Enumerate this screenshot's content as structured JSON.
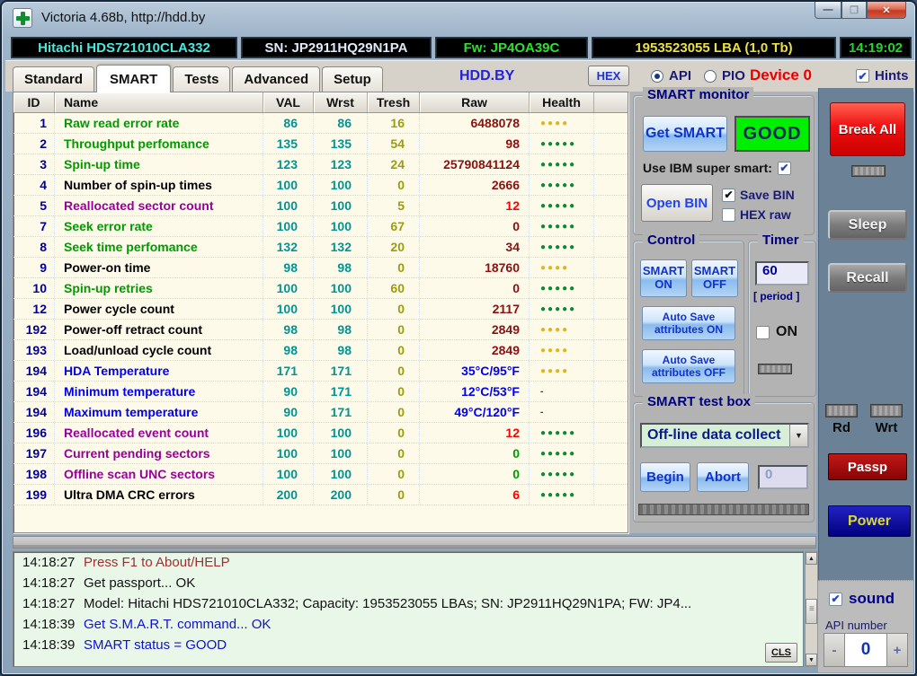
{
  "window": {
    "title": "Victoria 4.68b, http://hdd.by"
  },
  "info_bar": {
    "model": "Hitachi HDS721010CLA332",
    "serial": "SN: JP2911HQ29N1PA",
    "firmware": "Fw: JP4OA39C",
    "capacity": "1953523055 LBA (1,0 Tb)",
    "clock": "14:19:02"
  },
  "tab_bar": {
    "tabs": [
      "Standard",
      "SMART",
      "Tests",
      "Advanced",
      "Setup"
    ],
    "active_tab": "SMART",
    "site": "HDD.BY",
    "hex_button": "HEX",
    "api_label": "API",
    "pio_label": "PIO",
    "device_label": "Device 0",
    "hints_label": "Hints"
  },
  "table": {
    "columns": [
      "ID",
      "Name",
      "VAL",
      "Wrst",
      "Tresh",
      "Raw",
      "Health"
    ],
    "rows": [
      {
        "id": "1",
        "name": "Raw read error rate",
        "name_color": "green",
        "val": "86",
        "wrst": "86",
        "tresh": "16",
        "raw": "6488078",
        "raw_color": "maroon",
        "health_dots": 4,
        "health_color": "yellow"
      },
      {
        "id": "2",
        "name": "Throughput perfomance",
        "name_color": "green",
        "val": "135",
        "wrst": "135",
        "tresh": "54",
        "raw": "98",
        "raw_color": "maroon",
        "health_dots": 5,
        "health_color": "green"
      },
      {
        "id": "3",
        "name": "Spin-up time",
        "name_color": "green",
        "val": "123",
        "wrst": "123",
        "tresh": "24",
        "raw": "25790841124",
        "raw_color": "maroon",
        "health_dots": 5,
        "health_color": "green"
      },
      {
        "id": "4",
        "name": "Number of spin-up times",
        "name_color": "black",
        "val": "100",
        "wrst": "100",
        "tresh": "0",
        "raw": "2666",
        "raw_color": "maroon",
        "health_dots": 5,
        "health_color": "green"
      },
      {
        "id": "5",
        "name": "Reallocated sector count",
        "name_color": "purple",
        "val": "100",
        "wrst": "100",
        "tresh": "5",
        "raw": "12",
        "raw_color": "red",
        "health_dots": 5,
        "health_color": "green"
      },
      {
        "id": "7",
        "name": "Seek error rate",
        "name_color": "green",
        "val": "100",
        "wrst": "100",
        "tresh": "67",
        "raw": "0",
        "raw_color": "maroon",
        "health_dots": 5,
        "health_color": "green"
      },
      {
        "id": "8",
        "name": "Seek time perfomance",
        "name_color": "green",
        "val": "132",
        "wrst": "132",
        "tresh": "20",
        "raw": "34",
        "raw_color": "maroon",
        "health_dots": 5,
        "health_color": "green"
      },
      {
        "id": "9",
        "name": "Power-on time",
        "name_color": "black",
        "val": "98",
        "wrst": "98",
        "tresh": "0",
        "raw": "18760",
        "raw_color": "maroon",
        "health_dots": 4,
        "health_color": "yellow"
      },
      {
        "id": "10",
        "name": "Spin-up retries",
        "name_color": "green",
        "val": "100",
        "wrst": "100",
        "tresh": "60",
        "raw": "0",
        "raw_color": "maroon",
        "health_dots": 5,
        "health_color": "green"
      },
      {
        "id": "12",
        "name": "Power cycle count",
        "name_color": "black",
        "val": "100",
        "wrst": "100",
        "tresh": "0",
        "raw": "2117",
        "raw_color": "maroon",
        "health_dots": 5,
        "health_color": "green"
      },
      {
        "id": "192",
        "name": "Power-off retract count",
        "name_color": "black",
        "val": "98",
        "wrst": "98",
        "tresh": "0",
        "raw": "2849",
        "raw_color": "maroon",
        "health_dots": 4,
        "health_color": "yellow"
      },
      {
        "id": "193",
        "name": "Load/unload cycle count",
        "name_color": "black",
        "val": "98",
        "wrst": "98",
        "tresh": "0",
        "raw": "2849",
        "raw_color": "maroon",
        "health_dots": 4,
        "health_color": "yellow"
      },
      {
        "id": "194",
        "name": "HDA Temperature",
        "name_color": "blue",
        "val": "171",
        "wrst": "171",
        "tresh": "0",
        "raw": "35°C/95°F",
        "raw_color": "blue",
        "health_dots": 4,
        "health_color": "yellow"
      },
      {
        "id": "194",
        "name": "Minimum temperature",
        "name_color": "blue",
        "val": "90",
        "wrst": "171",
        "tresh": "0",
        "raw": "12°C/53°F",
        "raw_color": "blue",
        "health_dots": 0,
        "health_color": "dash"
      },
      {
        "id": "194",
        "name": "Maximum temperature",
        "name_color": "blue",
        "val": "90",
        "wrst": "171",
        "tresh": "0",
        "raw": "49°C/120°F",
        "raw_color": "blue",
        "health_dots": 0,
        "health_color": "dash"
      },
      {
        "id": "196",
        "name": "Reallocated event count",
        "name_color": "purple",
        "val": "100",
        "wrst": "100",
        "tresh": "0",
        "raw": "12",
        "raw_color": "red",
        "health_dots": 5,
        "health_color": "green"
      },
      {
        "id": "197",
        "name": "Current pending sectors",
        "name_color": "purple",
        "val": "100",
        "wrst": "100",
        "tresh": "0",
        "raw": "0",
        "raw_color": "green",
        "health_dots": 5,
        "health_color": "green"
      },
      {
        "id": "198",
        "name": "Offline scan UNC sectors",
        "name_color": "purple",
        "val": "100",
        "wrst": "100",
        "tresh": "0",
        "raw": "0",
        "raw_color": "green",
        "health_dots": 5,
        "health_color": "green"
      },
      {
        "id": "199",
        "name": "Ultra DMA CRC errors",
        "name_color": "black",
        "val": "200",
        "wrst": "200",
        "tresh": "0",
        "raw": "6",
        "raw_color": "red",
        "health_dots": 5,
        "health_color": "green"
      }
    ]
  },
  "smart_monitor": {
    "title": "SMART monitor",
    "get_smart_button": "Get SMART",
    "status": "GOOD",
    "ibm_label": "Use IBM super smart:",
    "open_bin_button": "Open BIN",
    "save_bin_label": "Save BIN",
    "hex_raw_label": "HEX raw",
    "status_color": "#00ef00"
  },
  "control": {
    "title": "Control",
    "smart_on_button": "SMART ON",
    "smart_off_button": "SMART OFF",
    "auto_on_button": "Auto Save attributes ON",
    "auto_off_button": "Auto Save attributes OFF"
  },
  "timer": {
    "title": "Timer",
    "period_value": "60",
    "period_label": "[ period ]",
    "on_label": "ON"
  },
  "test_box": {
    "title": "SMART test box",
    "selected_test": "Off-line data collect",
    "begin_button": "Begin",
    "abort_button": "Abort",
    "counter_value": "0"
  },
  "right_panel": {
    "break_all_button": "Break All",
    "sleep_button": "Sleep",
    "recall_button": "Recall",
    "rd_label": "Rd",
    "wrt_label": "Wrt",
    "passp_button": "Passp",
    "power_button": "Power",
    "sound_label": "sound",
    "api_number_label": "API number",
    "api_number_value": "0",
    "minus_button": "-",
    "plus_button": "+"
  },
  "log": {
    "cls_button": "CLS",
    "lines": [
      {
        "time": "14:18:27",
        "text": "Press F1 to About/HELP",
        "color": "maroon"
      },
      {
        "time": "14:18:27",
        "text": "Get passport... OK",
        "color": "black"
      },
      {
        "time": "14:18:27",
        "text": "Model: Hitachi HDS721010CLA332; Capacity: 1953523055 LBAs; SN: JP2911HQ29N1PA; FW: JP4...",
        "color": "black"
      },
      {
        "time": "14:18:39",
        "text": "Get S.M.A.R.T. command... OK",
        "color": "blue"
      },
      {
        "time": "14:18:39",
        "text": "SMART status = GOOD",
        "color": "blue"
      }
    ]
  }
}
